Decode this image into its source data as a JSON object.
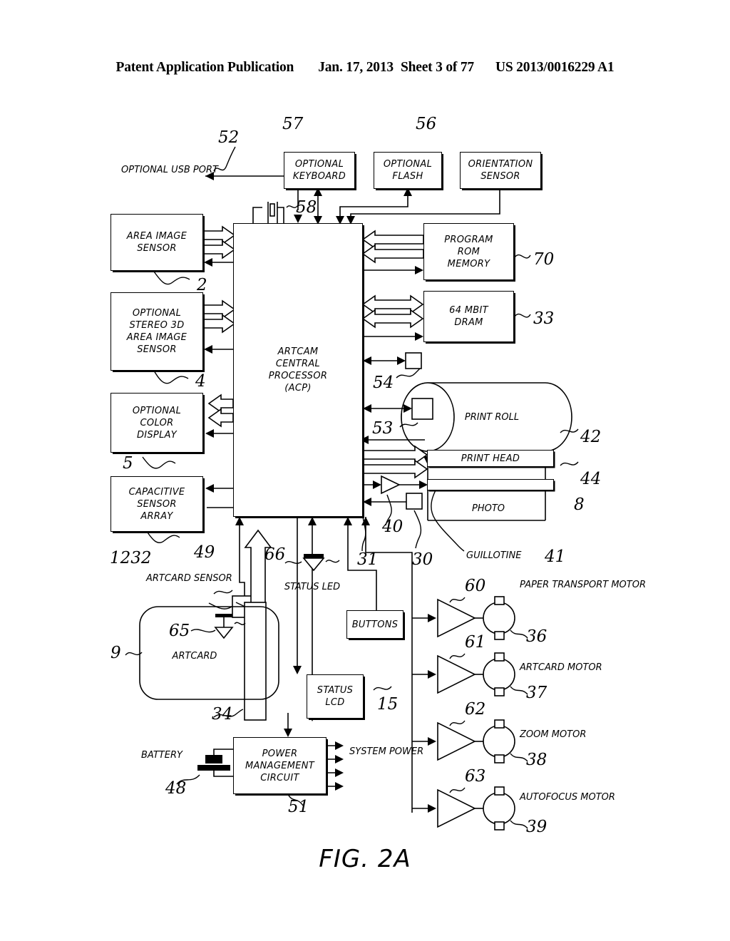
{
  "header": {
    "publication": "Patent Application Publication",
    "date": "Jan. 17, 2013",
    "sheet": "Sheet 3 of 77",
    "number": "US 2013/0016229 A1"
  },
  "figure": {
    "caption": "FIG. 2A"
  },
  "blocks": {
    "optional_usb_port": {
      "lines": [
        "OPTIONAL",
        "USB PORT"
      ],
      "ref": "52"
    },
    "optional_keyboard": {
      "lines": [
        "OPTIONAL",
        "KEYBOARD"
      ],
      "ref": "57"
    },
    "optional_flash": {
      "lines": [
        "OPTIONAL",
        "FLASH"
      ],
      "ref": "56"
    },
    "orientation_sensor": {
      "lines": [
        "ORIENTATION",
        "SENSOR"
      ],
      "ref": ""
    },
    "area_image_sensor": {
      "lines": [
        "AREA IMAGE",
        "SENSOR"
      ],
      "ref": "2"
    },
    "stereo_3d_sensor": {
      "lines": [
        "OPTIONAL",
        "STEREO 3D",
        "AREA IMAGE",
        "SENSOR"
      ],
      "ref": "4"
    },
    "color_display": {
      "lines": [
        "OPTIONAL",
        "COLOR",
        "DISPLAY"
      ],
      "ref": "5"
    },
    "capacitive_sensor_array": {
      "lines": [
        "CAPACITIVE",
        "SENSOR",
        "ARRAY"
      ],
      "ref": "1232"
    },
    "acp": {
      "lines": [
        "ARTCAM",
        "CENTRAL",
        "PROCESSOR",
        "(ACP)"
      ],
      "ref": ""
    },
    "program_rom": {
      "lines": [
        "PROGRAM",
        "ROM",
        "MEMORY"
      ],
      "ref": "70"
    },
    "dram": {
      "lines": [
        "64 MBIT",
        "DRAM"
      ],
      "ref": "33"
    },
    "print_roll": {
      "lines": [
        "PRINT ROLL"
      ],
      "ref": "42"
    },
    "print_head": {
      "lines": [
        "PRINT HEAD"
      ],
      "ref": "44"
    },
    "photo": {
      "lines": [
        "PHOTO"
      ],
      "ref": "8"
    },
    "guillotine": {
      "lines": [
        "GUILLOTINE"
      ],
      "ref": "41"
    },
    "artcard": {
      "lines": [
        "ARTCARD"
      ],
      "ref": "9"
    },
    "artcard_sensor": {
      "lines": [
        "ARTCARD",
        "SENSOR"
      ],
      "ref": "49"
    },
    "status_led": {
      "lines": [
        "STATUS",
        "LED"
      ],
      "ref": ""
    },
    "buttons": {
      "lines": [
        "BUTTONS"
      ],
      "ref": ""
    },
    "status_lcd": {
      "lines": [
        "STATUS",
        "LCD"
      ],
      "ref": "15"
    },
    "power_management": {
      "lines": [
        "POWER",
        "MANAGEMENT",
        "CIRCUIT"
      ],
      "ref": "51"
    },
    "battery": {
      "lines": [
        "BATTERY"
      ],
      "ref": "48"
    },
    "system_power": {
      "lines": [
        "SYSTEM",
        "POWER"
      ],
      "ref": ""
    },
    "paper_transport_motor": {
      "lines": [
        "PAPER",
        "TRANSPORT",
        "MOTOR"
      ],
      "ref": "36",
      "driver_ref": "60"
    },
    "artcard_motor": {
      "lines": [
        "ARTCARD",
        "MOTOR"
      ],
      "ref": "37",
      "driver_ref": "61"
    },
    "zoom_motor": {
      "lines": [
        "ZOOM",
        "MOTOR"
      ],
      "ref": "38",
      "driver_ref": "62"
    },
    "autofocus_motor": {
      "lines": [
        "AUTOFOCUS",
        "MOTOR"
      ],
      "ref": "39",
      "driver_ref": "63"
    }
  },
  "reference_numerals": {
    "n52": "52",
    "n57": "57",
    "n56": "56",
    "n58": "58",
    "n2": "2",
    "n4": "4",
    "n5": "5",
    "n1232": "1232",
    "n70": "70",
    "n33": "33",
    "n54": "54",
    "n53": "53",
    "n42": "42",
    "n44": "44",
    "n8": "8",
    "n40": "40",
    "n41": "41",
    "n30": "30",
    "n31": "31",
    "n49": "49",
    "n65": "65",
    "n66": "66",
    "n9": "9",
    "n34": "34",
    "n15": "15",
    "n48": "48",
    "n51": "51",
    "n60": "60",
    "n61": "61",
    "n62": "62",
    "n63": "63",
    "n36": "36",
    "n37": "37",
    "n38": "38",
    "n39": "39"
  },
  "colors": {
    "ink": "#000000",
    "paper": "#ffffff"
  }
}
